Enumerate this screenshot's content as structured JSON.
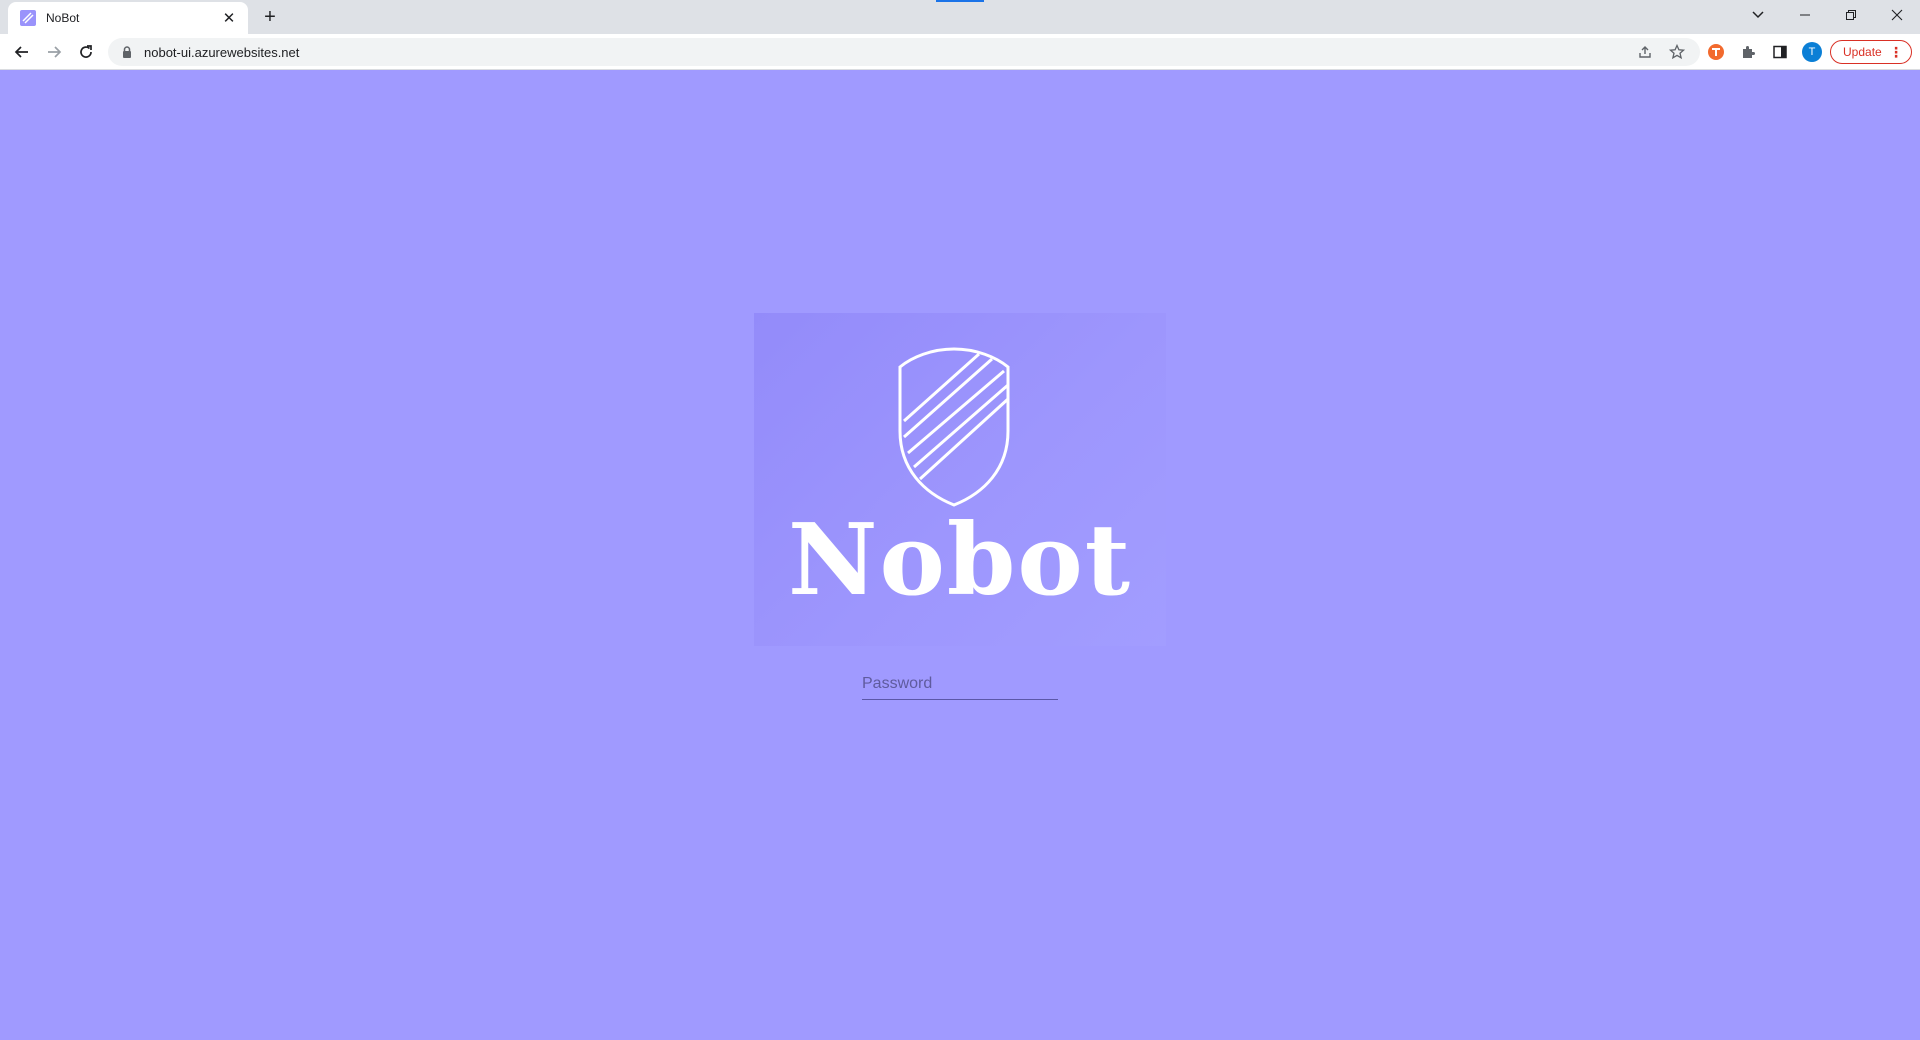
{
  "browser": {
    "tab": {
      "title": "NoBot"
    },
    "new_tab_label": "+",
    "address_bar": {
      "url": "nobot-ui.azurewebsites.net"
    },
    "profile_initial": "T",
    "update_button": {
      "label": "Update"
    }
  },
  "page": {
    "brand": {
      "wordmark": "Nobot"
    },
    "login": {
      "password_placeholder": "Password"
    }
  },
  "colors": {
    "page_background": "#a09aff",
    "logo_card": "#968ffb",
    "logo_stroke": "#ffffff",
    "update_accent": "#d93025",
    "avatar": "#0b7fd6"
  }
}
